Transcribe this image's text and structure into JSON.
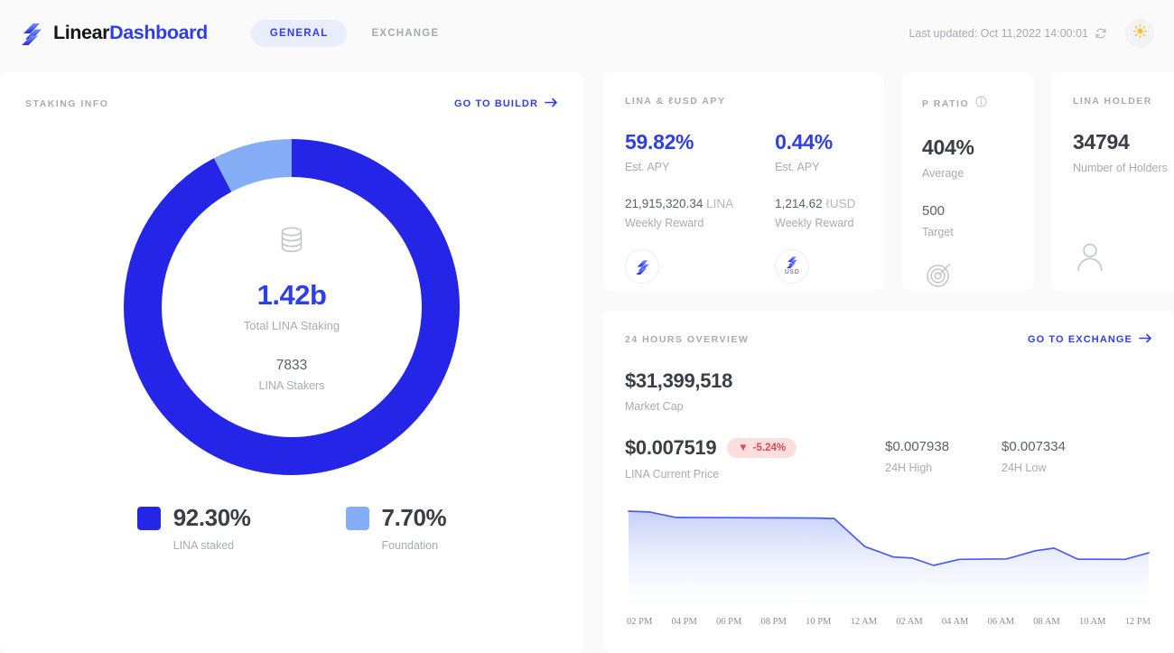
{
  "header": {
    "brand_primary": "Linear",
    "brand_accent": "Dashboard",
    "logo_icon": "linear-logo-icon",
    "tabs": [
      {
        "label": "GENERAL",
        "active": true
      },
      {
        "label": "EXCHANGE",
        "active": false
      }
    ],
    "last_updated": "Last updated: Oct 11,2022 14:00:01",
    "refresh_icon": "refresh-icon",
    "theme_icon": "sun-icon"
  },
  "staking": {
    "label": "STAKING INFO",
    "link": "GO TO BUILDR",
    "center_icon": "coins-stack-icon",
    "total_value": "1.42b",
    "total_caption": "Total LINA Staking",
    "stakers_count": "7833",
    "stakers_caption": "LINA Stakers",
    "legend": [
      {
        "percent": "92.30%",
        "name": "LINA staked",
        "color": "#2525e8"
      },
      {
        "percent": "7.70%",
        "name": "Foundation",
        "color": "#84adf5"
      }
    ]
  },
  "apy": {
    "label": "LINA & ℓUSD APY",
    "columns": [
      {
        "value": "59.82%",
        "caption": "Est. APY",
        "reward_amount": "21,915,320.34",
        "reward_unit": "LINA",
        "reward_caption": "Weekly Reward",
        "icon": "lina-token-icon",
        "icon_sub": ""
      },
      {
        "value": "0.44%",
        "caption": "Est. APY",
        "reward_amount": "1,214.62",
        "reward_unit": "ℓUSD",
        "reward_caption": "Weekly Reward",
        "icon": "lusd-token-icon",
        "icon_sub": "USD"
      }
    ]
  },
  "pratio": {
    "label": "P RATIO",
    "info_icon": "info-icon",
    "value": "404%",
    "caption": "Average",
    "target_value": "500",
    "target_caption": "Target",
    "icon": "target-icon"
  },
  "holder": {
    "label": "LINA HOLDER",
    "value": "34794",
    "caption": "Number of Holders",
    "icon": "person-icon"
  },
  "overview": {
    "label": "24 HOURS OVERVIEW",
    "link": "GO TO EXCHANGE",
    "market_cap": "$31,399,518",
    "market_cap_caption": "Market Cap",
    "price": "$0.007519",
    "price_caption": "LINA Current Price",
    "change_badge": "-5.24%",
    "change_arrow": "▼",
    "high_value": "$0.007938",
    "high_caption": "24H High",
    "low_value": "$0.007334",
    "low_caption": "24H Low"
  },
  "chart_data": {
    "type": "area",
    "title": "24 Hours Overview",
    "xlabel": "",
    "ylabel": "",
    "grid": false,
    "legend": "none",
    "line_color": "#4b5cef",
    "fill_gradient": [
      "#c9d2fa",
      "#ffffff"
    ],
    "categories": [
      "02 PM",
      "04 PM",
      "06 PM",
      "08 PM",
      "10 PM",
      "12 AM",
      "02 AM",
      "04 AM",
      "06 AM",
      "08 AM",
      "10 AM",
      "12 PM"
    ],
    "x": [
      0,
      1,
      2,
      3,
      4,
      5,
      6,
      7,
      8,
      9,
      10,
      11
    ],
    "values": [
      0.007938,
      0.007885,
      0.00788,
      0.007878,
      0.007876,
      0.00756,
      0.007455,
      0.007334,
      0.00747,
      0.00748,
      0.0076,
      0.00748,
      0.007479,
      0.007519
    ],
    "ylim": [
      0.007,
      0.008
    ],
    "points": [
      {
        "x": 0,
        "y": 0.007938
      },
      {
        "x": 0.45,
        "y": 0.00793
      },
      {
        "x": 1.0,
        "y": 0.007878
      },
      {
        "x": 4.0,
        "y": 0.007872
      },
      {
        "x": 4.35,
        "y": 0.007868
      },
      {
        "x": 5.0,
        "y": 0.0076
      },
      {
        "x": 5.6,
        "y": 0.0075
      },
      {
        "x": 6.0,
        "y": 0.00749
      },
      {
        "x": 6.45,
        "y": 0.00742
      },
      {
        "x": 7.0,
        "y": 0.007478
      },
      {
        "x": 8.0,
        "y": 0.007482
      },
      {
        "x": 8.6,
        "y": 0.00756
      },
      {
        "x": 9.0,
        "y": 0.007585
      },
      {
        "x": 9.5,
        "y": 0.00748
      },
      {
        "x": 10.5,
        "y": 0.007478
      },
      {
        "x": 11.0,
        "y": 0.00754
      }
    ]
  }
}
